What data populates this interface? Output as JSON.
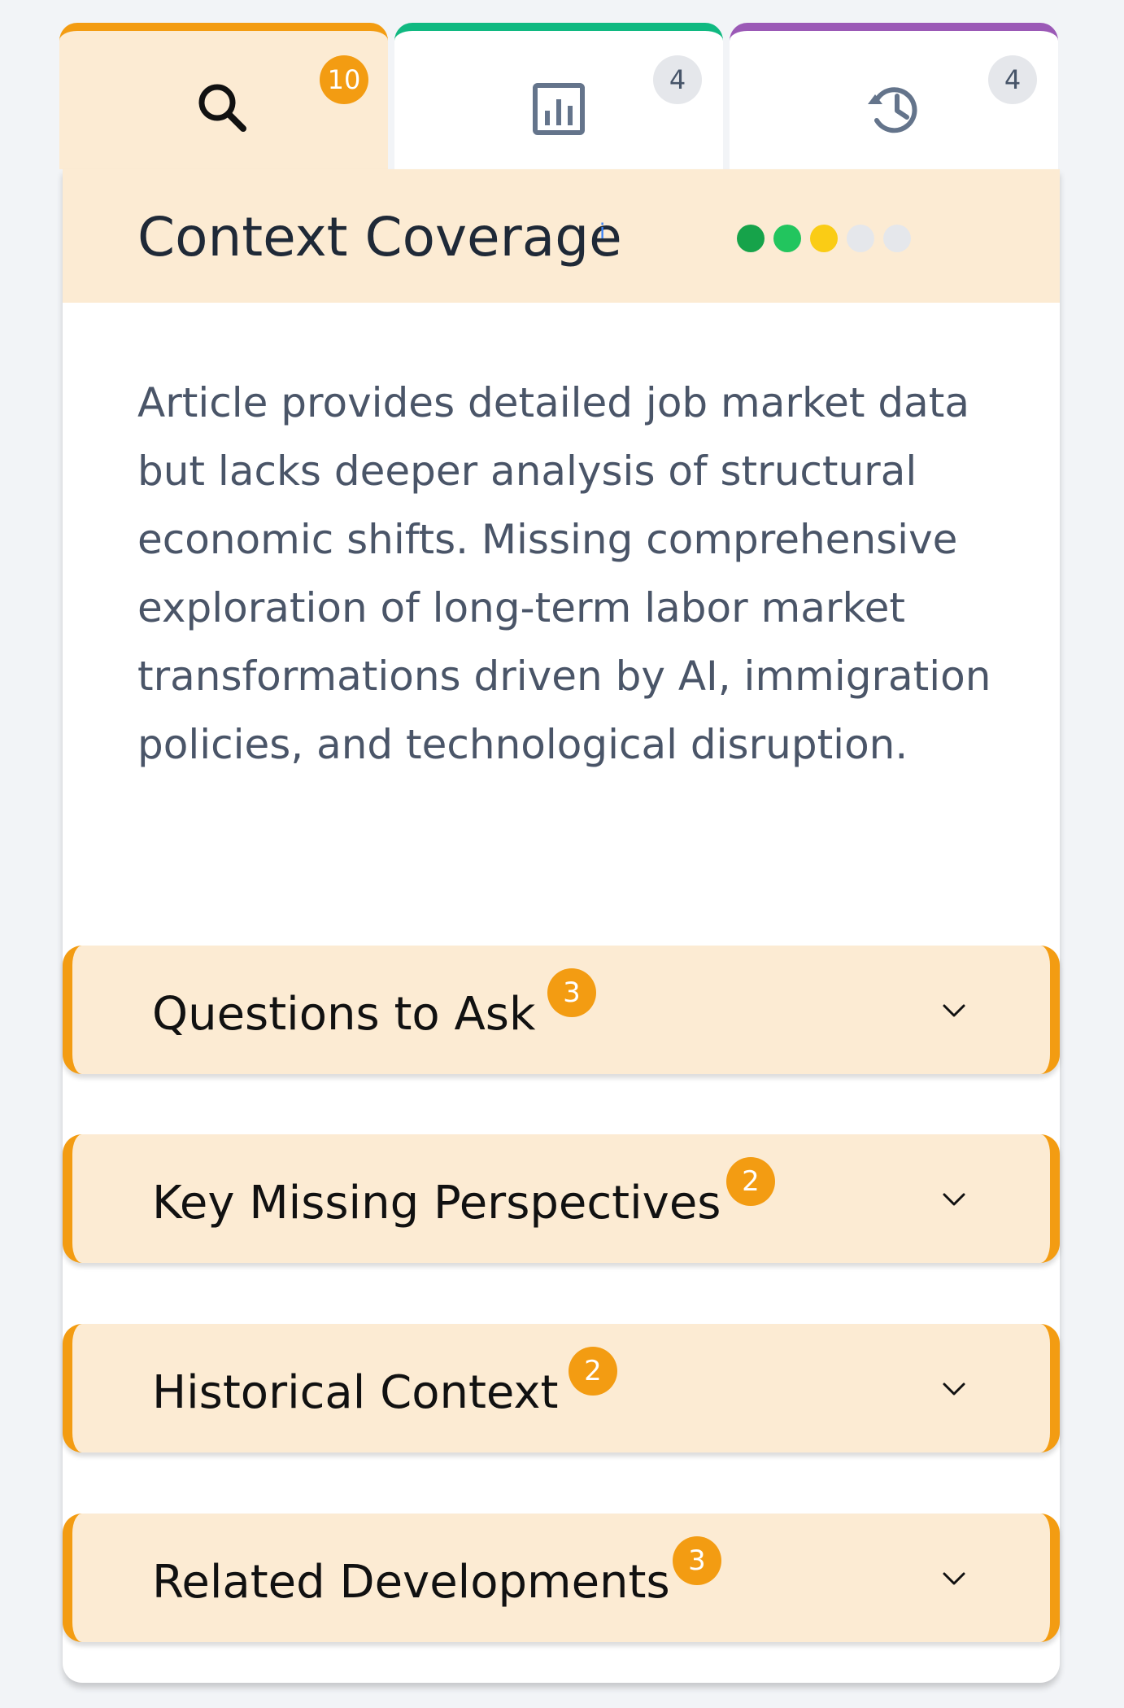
{
  "tabs": [
    {
      "icon": "search-icon",
      "count": "10",
      "accent": "#f39c12",
      "active": true
    },
    {
      "icon": "bar-chart-icon",
      "count": "4",
      "accent": "#10b981",
      "active": false
    },
    {
      "icon": "history-icon",
      "count": "4",
      "accent": "#9b59b6",
      "active": false
    }
  ],
  "coverage": {
    "title": "Context Coverage",
    "info": "i",
    "rating": 3,
    "rating_max": 5,
    "dot_colors": [
      "#16a34a",
      "#22c55e",
      "#facc15",
      "#e5e7eb",
      "#e5e7eb"
    ],
    "description": "Article provides detailed job market data but lacks deeper analysis of structural economic shifts. Missing comprehensive exploration of long-term labor market transformations driven by AI, immigration policies, and technological disruption."
  },
  "sections": [
    {
      "title": "Questions to Ask",
      "count": "3"
    },
    {
      "title": "Key Missing Perspectives",
      "count": "2"
    },
    {
      "title": "Historical Context",
      "count": "2"
    },
    {
      "title": "Related Developments",
      "count": "3"
    }
  ],
  "colors": {
    "accent": "#f39c12",
    "header_bg": "#fcebd3",
    "text": "#1f2937",
    "muted_text": "#4a5568"
  }
}
